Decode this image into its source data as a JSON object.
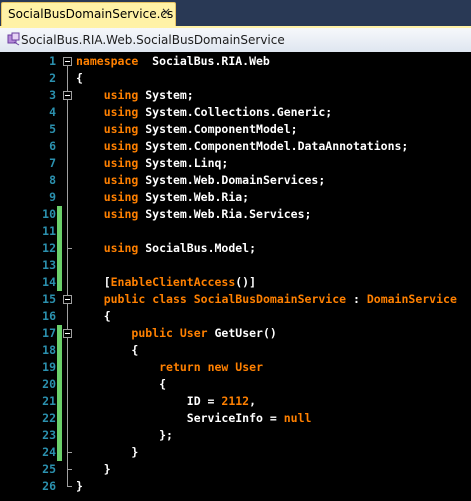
{
  "tab": {
    "title": "SocialBusDomainService.cs",
    "close": "×"
  },
  "nav": {
    "path": "SocialBus.RIA.Web.SocialBusDomainService"
  },
  "colors": {
    "keyword": "#ff8000",
    "text": "#ffffff",
    "line_number": "#2b91af",
    "change_bar": "#6bd06b",
    "background": "#000000"
  },
  "lines": [
    {
      "n": "1",
      "tokens": [
        [
          "kw",
          "namespace"
        ],
        [
          "",
          "  SocialBus.RIA.Web"
        ]
      ]
    },
    {
      "n": "2",
      "tokens": [
        [
          "",
          "{"
        ]
      ]
    },
    {
      "n": "3",
      "tokens": [
        [
          "",
          "    "
        ],
        [
          "kw",
          "using"
        ],
        [
          "",
          " System;"
        ]
      ]
    },
    {
      "n": "4",
      "tokens": [
        [
          "",
          "    "
        ],
        [
          "kw",
          "using"
        ],
        [
          "",
          " System.Collections.Generic;"
        ]
      ]
    },
    {
      "n": "5",
      "tokens": [
        [
          "",
          "    "
        ],
        [
          "kw",
          "using"
        ],
        [
          "",
          " System.ComponentModel;"
        ]
      ]
    },
    {
      "n": "6",
      "tokens": [
        [
          "",
          "    "
        ],
        [
          "kw",
          "using"
        ],
        [
          "",
          " System.ComponentModel.DataAnnotations;"
        ]
      ]
    },
    {
      "n": "7",
      "tokens": [
        [
          "",
          "    "
        ],
        [
          "kw",
          "using"
        ],
        [
          "",
          " System.Linq;"
        ]
      ]
    },
    {
      "n": "8",
      "tokens": [
        [
          "",
          "    "
        ],
        [
          "kw",
          "using"
        ],
        [
          "",
          " System.Web.DomainServices;"
        ]
      ]
    },
    {
      "n": "9",
      "tokens": [
        [
          "",
          "    "
        ],
        [
          "kw",
          "using"
        ],
        [
          "",
          " System.Web.Ria;"
        ]
      ]
    },
    {
      "n": "10",
      "tokens": [
        [
          "",
          "    "
        ],
        [
          "kw",
          "using"
        ],
        [
          "",
          " System.Web.Ria.Services;"
        ]
      ]
    },
    {
      "n": "11",
      "tokens": []
    },
    {
      "n": "12",
      "tokens": [
        [
          "",
          "    "
        ],
        [
          "kw",
          "using"
        ],
        [
          "",
          " SocialBus.Model;"
        ]
      ]
    },
    {
      "n": "13",
      "tokens": []
    },
    {
      "n": "14",
      "tokens": [
        [
          "",
          "    ["
        ],
        [
          "ty",
          "EnableClientAccess"
        ],
        [
          "",
          "()]"
        ]
      ]
    },
    {
      "n": "15",
      "tokens": [
        [
          "",
          "    "
        ],
        [
          "kw",
          "public"
        ],
        [
          "",
          " "
        ],
        [
          "kw",
          "class"
        ],
        [
          "",
          " "
        ],
        [
          "cls",
          "SocialBusDomainService"
        ],
        [
          "",
          " : "
        ],
        [
          "ty",
          "DomainService"
        ]
      ]
    },
    {
      "n": "16",
      "tokens": [
        [
          "",
          "    {"
        ]
      ]
    },
    {
      "n": "17",
      "tokens": [
        [
          "",
          "        "
        ],
        [
          "kw",
          "public"
        ],
        [
          "",
          " "
        ],
        [
          "ty",
          "User"
        ],
        [
          "",
          " GetUser()"
        ]
      ]
    },
    {
      "n": "18",
      "tokens": [
        [
          "",
          "        {"
        ]
      ]
    },
    {
      "n": "19",
      "tokens": [
        [
          "",
          "            "
        ],
        [
          "kw",
          "return"
        ],
        [
          "",
          " "
        ],
        [
          "kw",
          "new"
        ],
        [
          "",
          " "
        ],
        [
          "ty",
          "User"
        ]
      ]
    },
    {
      "n": "20",
      "tokens": [
        [
          "",
          "            {"
        ]
      ]
    },
    {
      "n": "21",
      "tokens": [
        [
          "",
          "                ID = "
        ],
        [
          "num",
          "2112"
        ],
        [
          "",
          ","
        ]
      ]
    },
    {
      "n": "22",
      "tokens": [
        [
          "",
          "                ServiceInfo = "
        ],
        [
          "kw",
          "null"
        ]
      ]
    },
    {
      "n": "23",
      "tokens": [
        [
          "",
          "            };"
        ]
      ]
    },
    {
      "n": "24",
      "tokens": [
        [
          "",
          "        }"
        ]
      ]
    },
    {
      "n": "25",
      "tokens": [
        [
          "",
          "    }"
        ]
      ]
    },
    {
      "n": "26",
      "tokens": [
        [
          "",
          "}"
        ]
      ]
    }
  ],
  "changed_lines": [
    "10",
    "11",
    "12",
    "13",
    "14",
    "17",
    "18",
    "19",
    "20",
    "21",
    "22",
    "23",
    "24"
  ]
}
